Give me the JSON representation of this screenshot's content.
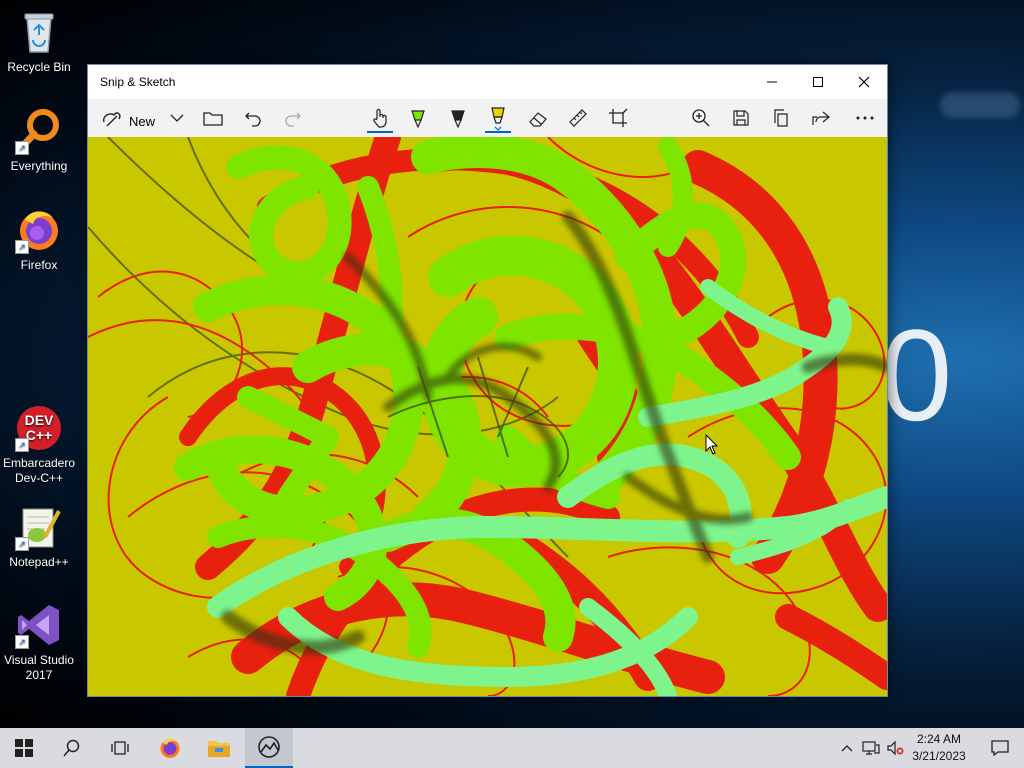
{
  "desktop": {
    "wallpaper_glyph": "0",
    "icons": [
      {
        "label": "Recycle Bin"
      },
      {
        "label": "Everything"
      },
      {
        "label": "Firefox"
      },
      {
        "label": "Embarcadero Dev-C++"
      },
      {
        "label": "Notepad++"
      },
      {
        "label": "Visual Studio 2017"
      }
    ]
  },
  "window": {
    "title": "Snip & Sketch",
    "toolbar": {
      "new_label": "New",
      "tools": [
        {
          "name": "touch-writing",
          "icon": "hand-icon"
        },
        {
          "name": "ballpoint-pen",
          "icon": "pen-icon"
        },
        {
          "name": "pencil",
          "icon": "pencil-icon"
        },
        {
          "name": "highlighter",
          "icon": "highlighter-icon",
          "selected": true
        },
        {
          "name": "eraser",
          "icon": "eraser-icon"
        },
        {
          "name": "ruler",
          "icon": "ruler-icon"
        },
        {
          "name": "crop",
          "icon": "crop-icon"
        }
      ],
      "right_tools": [
        "zoom-icon",
        "save-icon",
        "copy-icon",
        "share-icon",
        "more-icon"
      ]
    },
    "canvas": {
      "background_color": "#c9c800",
      "stroke_colors": [
        "#e8200e",
        "#7fe500",
        "#7ef58c",
        "#3b3f14"
      ]
    }
  },
  "taskbar": {
    "time": "2:24 AM",
    "date": "3/21/2023",
    "accent": "#0067c0"
  }
}
